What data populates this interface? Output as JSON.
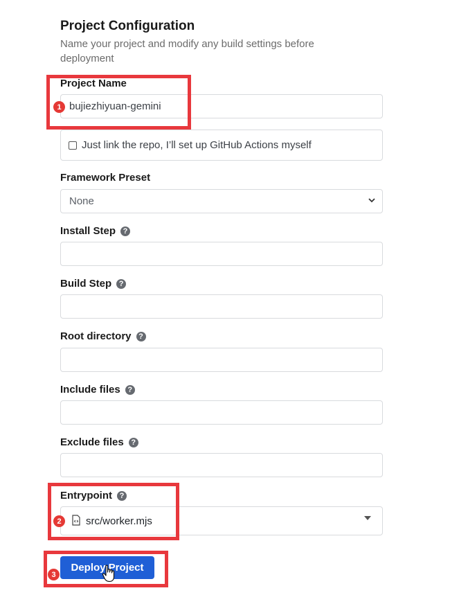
{
  "header": {
    "title": "Project Configuration",
    "subtitle": "Name your project and modify any build settings before deployment"
  },
  "project_name": {
    "label": "Project Name",
    "value": "bujiezhiyuan-gemini"
  },
  "github_actions": {
    "label": "Just link the repo, I’ll set up GitHub Actions myself",
    "checked": false
  },
  "framework_preset": {
    "label": "Framework Preset",
    "value": "None"
  },
  "install_step": {
    "label": "Install Step",
    "value": ""
  },
  "build_step": {
    "label": "Build Step",
    "value": ""
  },
  "root_directory": {
    "label": "Root directory",
    "value": ""
  },
  "include_files": {
    "label": "Include files",
    "value": ""
  },
  "exclude_files": {
    "label": "Exclude files",
    "value": ""
  },
  "entrypoint": {
    "label": "Entrypoint",
    "value": "src/worker.mjs"
  },
  "deploy_button": {
    "label": "Deploy Project"
  },
  "help_glyph": "?",
  "annotations": {
    "badge_1": "1",
    "badge_2": "2",
    "badge_3": "3"
  },
  "colors": {
    "accent": "#1f5fd6",
    "annotation": "#e8383d"
  }
}
